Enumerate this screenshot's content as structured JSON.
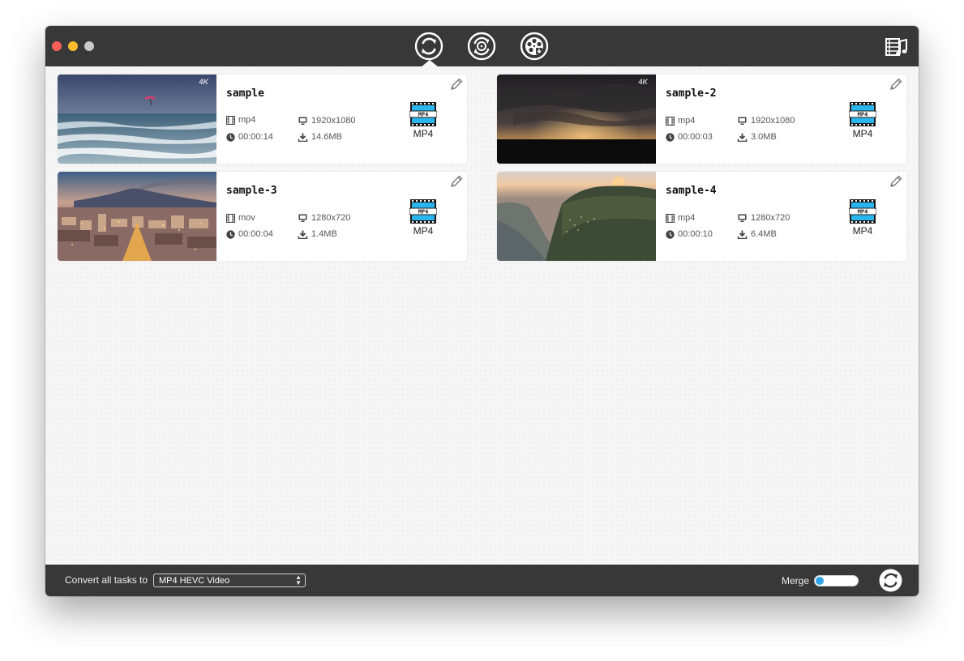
{
  "toolbar": {
    "tabs": [
      {
        "name": "convert",
        "icon": "convert-icon"
      },
      {
        "name": "dvd-rip",
        "icon": "disc-convert-icon"
      },
      {
        "name": "download",
        "icon": "film-reel-download-icon"
      }
    ],
    "toolbox_icon": "film-music-icon"
  },
  "tasks": [
    {
      "name": "sample",
      "container": "mp4",
      "duration": "00:00:14",
      "resolution": "1920x1080",
      "size": "14.6MB",
      "badge": "4K",
      "output_format": "MP4",
      "thumbnail": "beach-waves"
    },
    {
      "name": "sample-2",
      "container": "mp4",
      "duration": "00:00:03",
      "resolution": "1920x1080",
      "size": "3.0MB",
      "badge": "4K",
      "output_format": "MP4",
      "thumbnail": "sunset-clouds"
    },
    {
      "name": "sample-3",
      "container": "mov",
      "duration": "00:00:04",
      "resolution": "1280x720",
      "size": "1.4MB",
      "badge": "",
      "output_format": "MP4",
      "thumbnail": "city-volcano"
    },
    {
      "name": "sample-4",
      "container": "mp4",
      "duration": "00:00:10",
      "resolution": "1280x720",
      "size": "6.4MB",
      "badge": "",
      "output_format": "MP4",
      "thumbnail": "coast-sunset"
    }
  ],
  "bottom": {
    "convert_label": "Convert all tasks to",
    "selected_format": "MP4 HEVC Video",
    "merge_label": "Merge",
    "merge_on": false
  },
  "colors": {
    "chrome": "#383838",
    "accent": "#2fa4e7"
  }
}
